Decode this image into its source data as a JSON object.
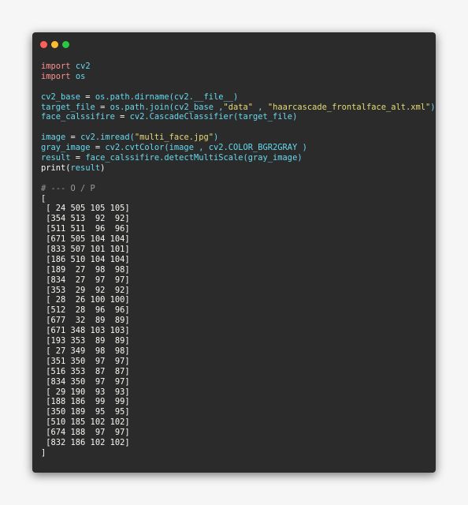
{
  "code_lines": [
    {
      "type": "import",
      "kw": "import",
      "mod": "cv2"
    },
    {
      "type": "import",
      "kw": "import",
      "mod": "os"
    },
    {
      "type": "blank"
    },
    {
      "type": "call",
      "lhs": "cv2_base",
      "op": " = ",
      "call": "os.path.dirname(cv2.__file__)"
    },
    {
      "type": "target",
      "lhs": "target_file",
      "op": " = ",
      "pre": "os.path.join(cv2_base ,",
      "s1": "\"data\"",
      "mid": " , ",
      "s2": "\"haarcascade_frontalface_alt.xml\"",
      "post": ")"
    },
    {
      "type": "call",
      "lhs": "face_calssifire",
      "op": " = ",
      "call": "cv2.CascadeClassifier(target_file)"
    },
    {
      "type": "blank"
    },
    {
      "type": "strcall",
      "lhs": "image",
      "op": " = ",
      "pre": "cv2.imread(",
      "s1": "\"multi_face.jpg\"",
      "post": ")"
    },
    {
      "type": "call",
      "lhs": "gray_image",
      "op": " = ",
      "call": "cv2.cvtColor(image , cv2.COLOR_BGR2GRAY )"
    },
    {
      "type": "call",
      "lhs": "result",
      "op": " = ",
      "call": "face_calssifire.detectMultiScale(gray_image)"
    },
    {
      "type": "print",
      "fn": "print(",
      "arg": "result",
      ")": ")"
    },
    {
      "type": "blank"
    },
    {
      "type": "comment",
      "text": "# --- O / P"
    }
  ],
  "output_lines": [
    "[",
    " [ 24 505 105 105]",
    " [354 513  92  92]",
    " [511 511  96  96]",
    " [671 505 104 104]",
    " [833 507 101 101]",
    " [186 510 104 104]",
    " [189  27  98  98]",
    " [834  27  97  97]",
    " [353  29  92  92]",
    " [ 28  26 100 100]",
    " [512  28  96  96]",
    " [677  32  89  89]",
    " [671 348 103 103]",
    " [193 353  89  89]",
    " [ 27 349  98  98]",
    " [351 350  97  97]",
    " [516 353  87  87]",
    " [834 350  97  97]",
    " [ 29 190  93  93]",
    " [188 186  99  99]",
    " [350 189  95  95]",
    " [510 185 102 102]",
    " [674 188  97  97]",
    " [832 186 102 102]",
    "]"
  ]
}
